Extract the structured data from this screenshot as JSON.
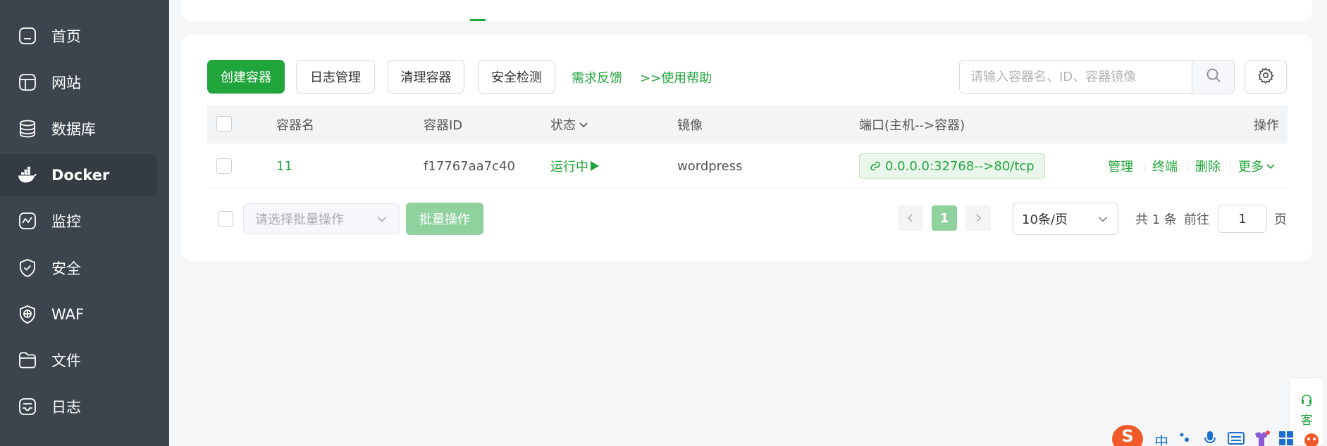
{
  "sidebar": {
    "items": [
      {
        "label": "首页",
        "icon": "home-icon"
      },
      {
        "label": "网站",
        "icon": "website-icon"
      },
      {
        "label": "数据库",
        "icon": "database-icon"
      },
      {
        "label": "Docker",
        "icon": "docker-icon",
        "active": true
      },
      {
        "label": "监控",
        "icon": "monitor-icon"
      },
      {
        "label": "安全",
        "icon": "shield-icon"
      },
      {
        "label": "WAF",
        "icon": "waf-icon"
      },
      {
        "label": "文件",
        "icon": "folder-icon"
      },
      {
        "label": "日志",
        "icon": "log-icon"
      }
    ]
  },
  "toolbar": {
    "create_label": "创建容器",
    "logs_label": "日志管理",
    "clean_label": "清理容器",
    "security_label": "安全检测",
    "feedback_label": "需求反馈",
    "help_label": ">>使用帮助",
    "search_placeholder": "请输入容器名、ID、容器镜像"
  },
  "table": {
    "headers": {
      "name": "容器名",
      "id": "容器ID",
      "status": "状态",
      "image": "镜像",
      "ports": "端口(主机-->容器)",
      "actions": "操作"
    },
    "rows": [
      {
        "name": "11",
        "id": "f17767aa7c40",
        "status": "运行中",
        "image": "wordpress",
        "ports": "0.0.0.0:32768-->80/tcp",
        "actions": [
          "管理",
          "终端",
          "删除",
          "更多"
        ]
      }
    ]
  },
  "footer": {
    "batch_placeholder": "请选择批量操作",
    "batch_button": "批量操作",
    "current_page": "1",
    "page_size": "10条/页",
    "total": "共 1 条",
    "goto_prefix": "前往",
    "goto_value": "1",
    "goto_suffix": "页"
  },
  "widget": {
    "cs_label": "客"
  },
  "ime": {
    "logo": "S",
    "mode": "中"
  },
  "colors": {
    "accent": "#20a53a",
    "sidebar_bg": "#3c444d",
    "page_bg": "#f4f6f7"
  }
}
